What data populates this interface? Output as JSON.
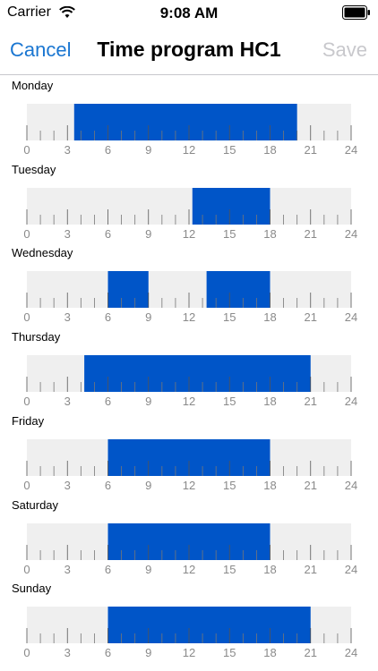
{
  "status_bar": {
    "carrier": "Carrier",
    "time": "9:08 AM",
    "wifi_icon": "wifi-icon",
    "battery_icon": "battery-icon"
  },
  "nav": {
    "cancel_label": "Cancel",
    "title": "Time program HC1",
    "save_label": "Save"
  },
  "colors": {
    "accent": "#1a76d1",
    "active_block": "#0055c8",
    "track": "#efefef",
    "disabled": "#c8c8cc",
    "tick_label": "#8a8a8a"
  },
  "axis_labels": [
    "0",
    "3",
    "6",
    "9",
    "12",
    "15",
    "18",
    "21",
    "24"
  ],
  "days": [
    {
      "label": "Monday",
      "blocks": [
        [
          3.5,
          20.0
        ]
      ]
    },
    {
      "label": "Tuesday",
      "blocks": [
        [
          12.25,
          18.0
        ]
      ]
    },
    {
      "label": "Wednesday",
      "blocks": [
        [
          6.0,
          9.0
        ],
        [
          13.3,
          18.0
        ]
      ]
    },
    {
      "label": "Thursday",
      "blocks": [
        [
          4.25,
          21.0
        ]
      ]
    },
    {
      "label": "Friday",
      "blocks": [
        [
          6.0,
          18.0
        ]
      ]
    },
    {
      "label": "Saturday",
      "blocks": [
        [
          6.0,
          18.0
        ]
      ]
    },
    {
      "label": "Sunday",
      "blocks": [
        [
          6.0,
          21.0
        ]
      ]
    }
  ]
}
